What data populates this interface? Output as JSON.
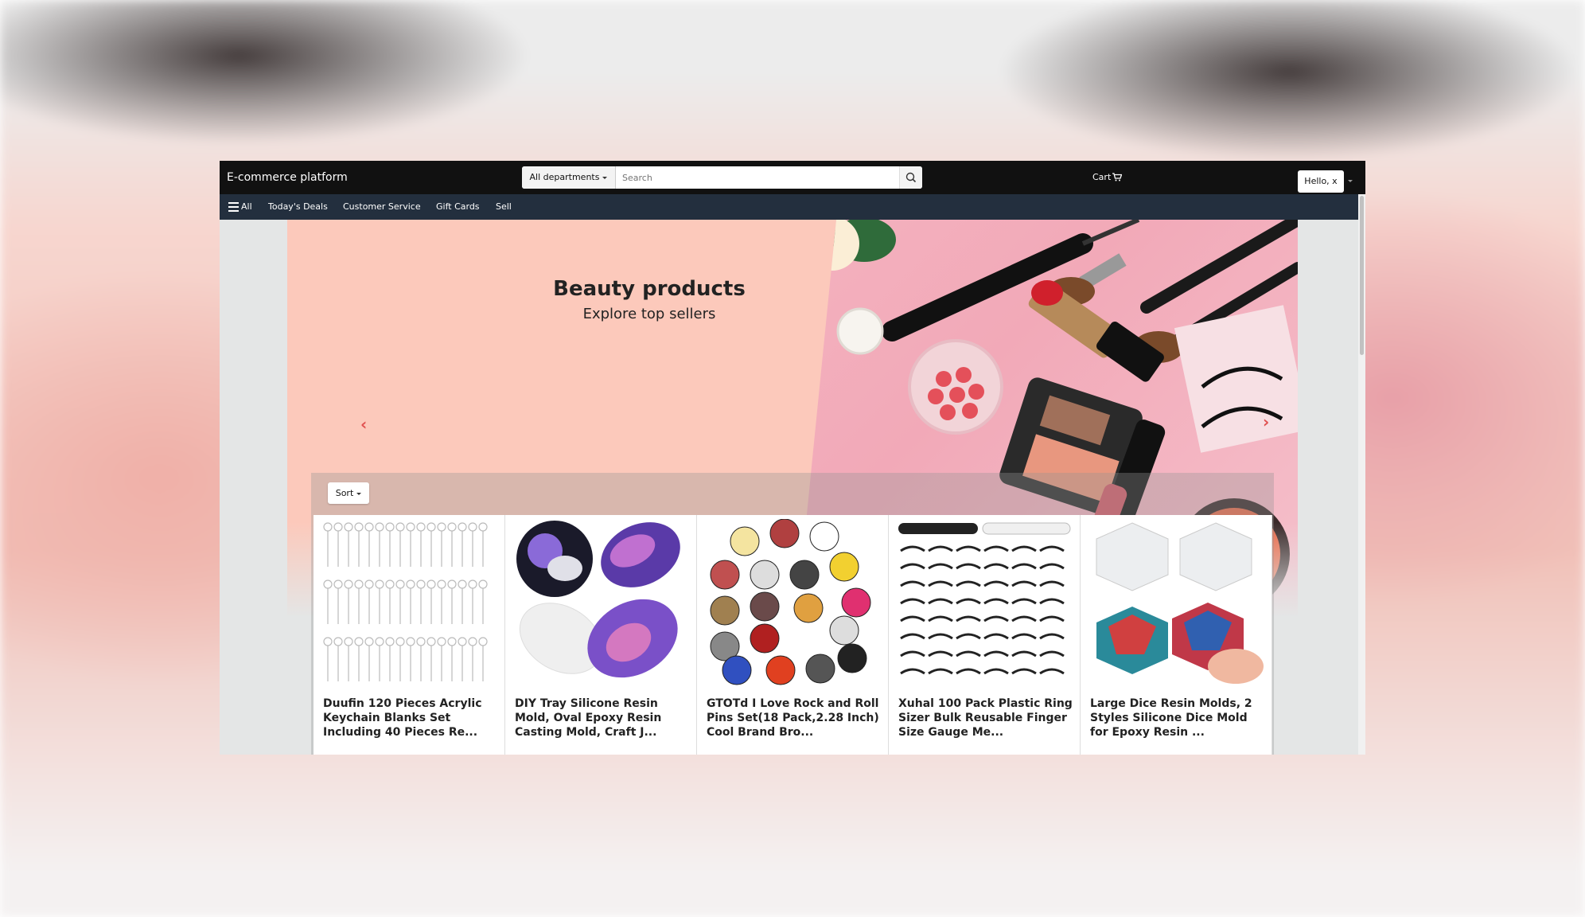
{
  "header": {
    "brand": "E-commerce platform",
    "department_label": "All departments",
    "search_placeholder": "Search",
    "cart_label": "Cart",
    "user_label": "Hello, x"
  },
  "nav": {
    "all_label": "All",
    "items": [
      "Today's Deals",
      "Customer Service",
      "Gift Cards",
      "Sell"
    ]
  },
  "hero": {
    "title": "Beauty products",
    "subtitle": "Explore top sellers",
    "accent_color": "#fcc9bb"
  },
  "results": {
    "sort_label": "Sort",
    "products": [
      {
        "title": "Duufin 120 Pieces Acrylic Keychain Blanks Set Including 40 Pieces Re...",
        "image": "keychain-blanks"
      },
      {
        "title": "DIY Tray Silicone Resin Mold, Oval Epoxy Resin Casting Mold, Craft J...",
        "image": "resin-trays"
      },
      {
        "title": "GTOTd I Love Rock and Roll Pins Set(18 Pack,2.28 Inch)  Cool Brand Bro...",
        "image": "rock-pins"
      },
      {
        "title": "Xuhal 100 Pack Plastic Ring Sizer Bulk Reusable Finger Size Gauge Me...",
        "image": "ring-sizers"
      },
      {
        "title": "Large Dice Resin Molds, 2 Styles Silicone Dice Mold for Epoxy Resin ...",
        "image": "dice-molds"
      }
    ]
  }
}
